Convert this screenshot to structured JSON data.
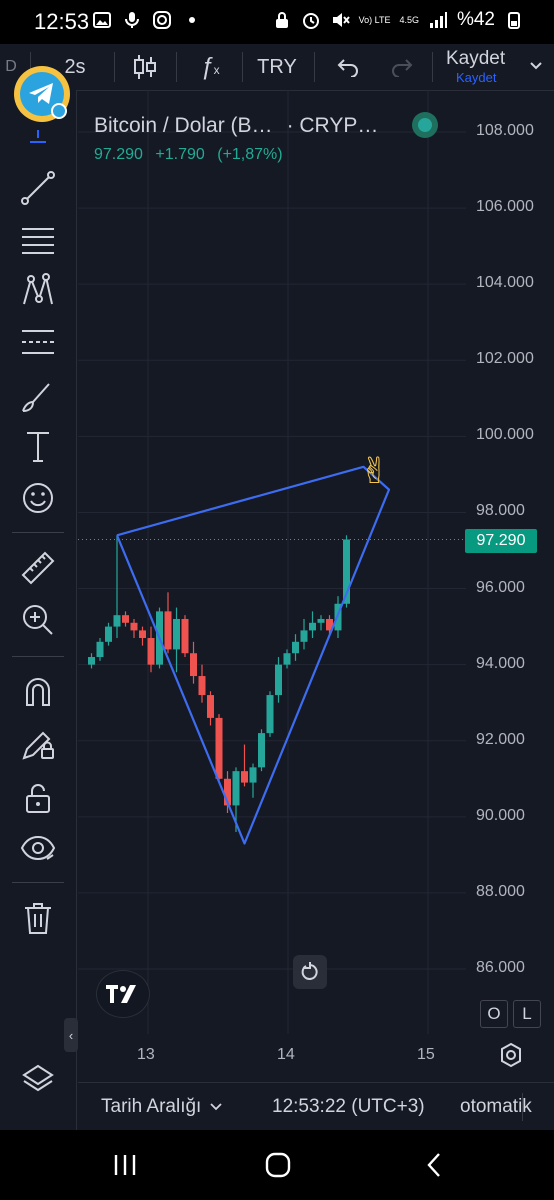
{
  "status_bar": {
    "time": "12:53",
    "network": "Vo) LTE",
    "network_gen": "4.5G",
    "battery": "%42"
  },
  "toolbar": {
    "interval": "2s",
    "currency": "TRY",
    "save_label": "Kaydet",
    "save_sub": "Kaydet"
  },
  "legend": {
    "symbol": "Bitcoin / Dolar (B…",
    "exchange": "· CRYP…",
    "last": "97.290",
    "change": "+1.790",
    "change_pct": "(+1,87%)"
  },
  "price_tag": "97.290",
  "price_axis": [
    "108.000",
    "106.000",
    "104.000",
    "102.000",
    "100.000",
    "98.000",
    "96.000",
    "94.000",
    "92.000",
    "90.000",
    "88.000",
    "86.000"
  ],
  "time_axis": [
    "13",
    "14",
    "15"
  ],
  "buttons": {
    "o": "O",
    "l": "L"
  },
  "bottom_bar": {
    "range": "Tarih Aralığı",
    "clock": "12:53:22 (UTC+3)",
    "scale": "otomatik"
  },
  "colors": {
    "up": "#26a69a",
    "down": "#ef5350",
    "drawing": "#3d6cf0",
    "bg": "#151924"
  },
  "chart_data": {
    "type": "candlestick",
    "ylim": [
      85000,
      109000
    ],
    "candles": [
      {
        "o": 94000,
        "h": 94300,
        "l": 93900,
        "c": 94200
      },
      {
        "o": 94200,
        "h": 94700,
        "l": 94100,
        "c": 94600
      },
      {
        "o": 94600,
        "h": 95100,
        "l": 94500,
        "c": 95000
      },
      {
        "o": 95000,
        "h": 97400,
        "l": 94700,
        "c": 95300
      },
      {
        "o": 95300,
        "h": 95400,
        "l": 95000,
        "c": 95100
      },
      {
        "o": 95100,
        "h": 95200,
        "l": 94700,
        "c": 94900
      },
      {
        "o": 94900,
        "h": 95000,
        "l": 94500,
        "c": 94700
      },
      {
        "o": 94700,
        "h": 95000,
        "l": 93800,
        "c": 94000
      },
      {
        "o": 94000,
        "h": 95500,
        "l": 93900,
        "c": 95400
      },
      {
        "o": 95400,
        "h": 95900,
        "l": 94300,
        "c": 94400
      },
      {
        "o": 94400,
        "h": 95500,
        "l": 93800,
        "c": 95200
      },
      {
        "o": 95200,
        "h": 95300,
        "l": 94200,
        "c": 94300
      },
      {
        "o": 94300,
        "h": 94600,
        "l": 93500,
        "c": 93700
      },
      {
        "o": 93700,
        "h": 94000,
        "l": 93000,
        "c": 93200
      },
      {
        "o": 93200,
        "h": 93300,
        "l": 92400,
        "c": 92600
      },
      {
        "o": 92600,
        "h": 92700,
        "l": 90900,
        "c": 91000
      },
      {
        "o": 91000,
        "h": 91200,
        "l": 90100,
        "c": 90300
      },
      {
        "o": 90300,
        "h": 91300,
        "l": 89600,
        "c": 91200
      },
      {
        "o": 91200,
        "h": 91900,
        "l": 90800,
        "c": 90900
      },
      {
        "o": 90900,
        "h": 91400,
        "l": 90500,
        "c": 91300
      },
      {
        "o": 91300,
        "h": 92300,
        "l": 91200,
        "c": 92200
      },
      {
        "o": 92200,
        "h": 93300,
        "l": 92100,
        "c": 93200
      },
      {
        "o": 93200,
        "h": 94200,
        "l": 93000,
        "c": 94000
      },
      {
        "o": 94000,
        "h": 94400,
        "l": 93900,
        "c": 94300
      },
      {
        "o": 94300,
        "h": 94800,
        "l": 94100,
        "c": 94600
      },
      {
        "o": 94600,
        "h": 95200,
        "l": 94400,
        "c": 94900
      },
      {
        "o": 94900,
        "h": 95400,
        "l": 94700,
        "c": 95100
      },
      {
        "o": 95100,
        "h": 95300,
        "l": 94900,
        "c": 95200
      },
      {
        "o": 95200,
        "h": 95300,
        "l": 94800,
        "c": 94900
      },
      {
        "o": 94900,
        "h": 95800,
        "l": 94700,
        "c": 95600
      },
      {
        "o": 95600,
        "h": 97400,
        "l": 95500,
        "c": 97290
      }
    ],
    "drawing": {
      "type": "triangle",
      "points": [
        {
          "candle": 3,
          "price": 97400
        },
        {
          "candle": 18,
          "price": 89300
        },
        {
          "candle": 35,
          "price": 98600
        },
        {
          "candle": 32,
          "price": 99200
        }
      ]
    },
    "last_price": 97290
  }
}
